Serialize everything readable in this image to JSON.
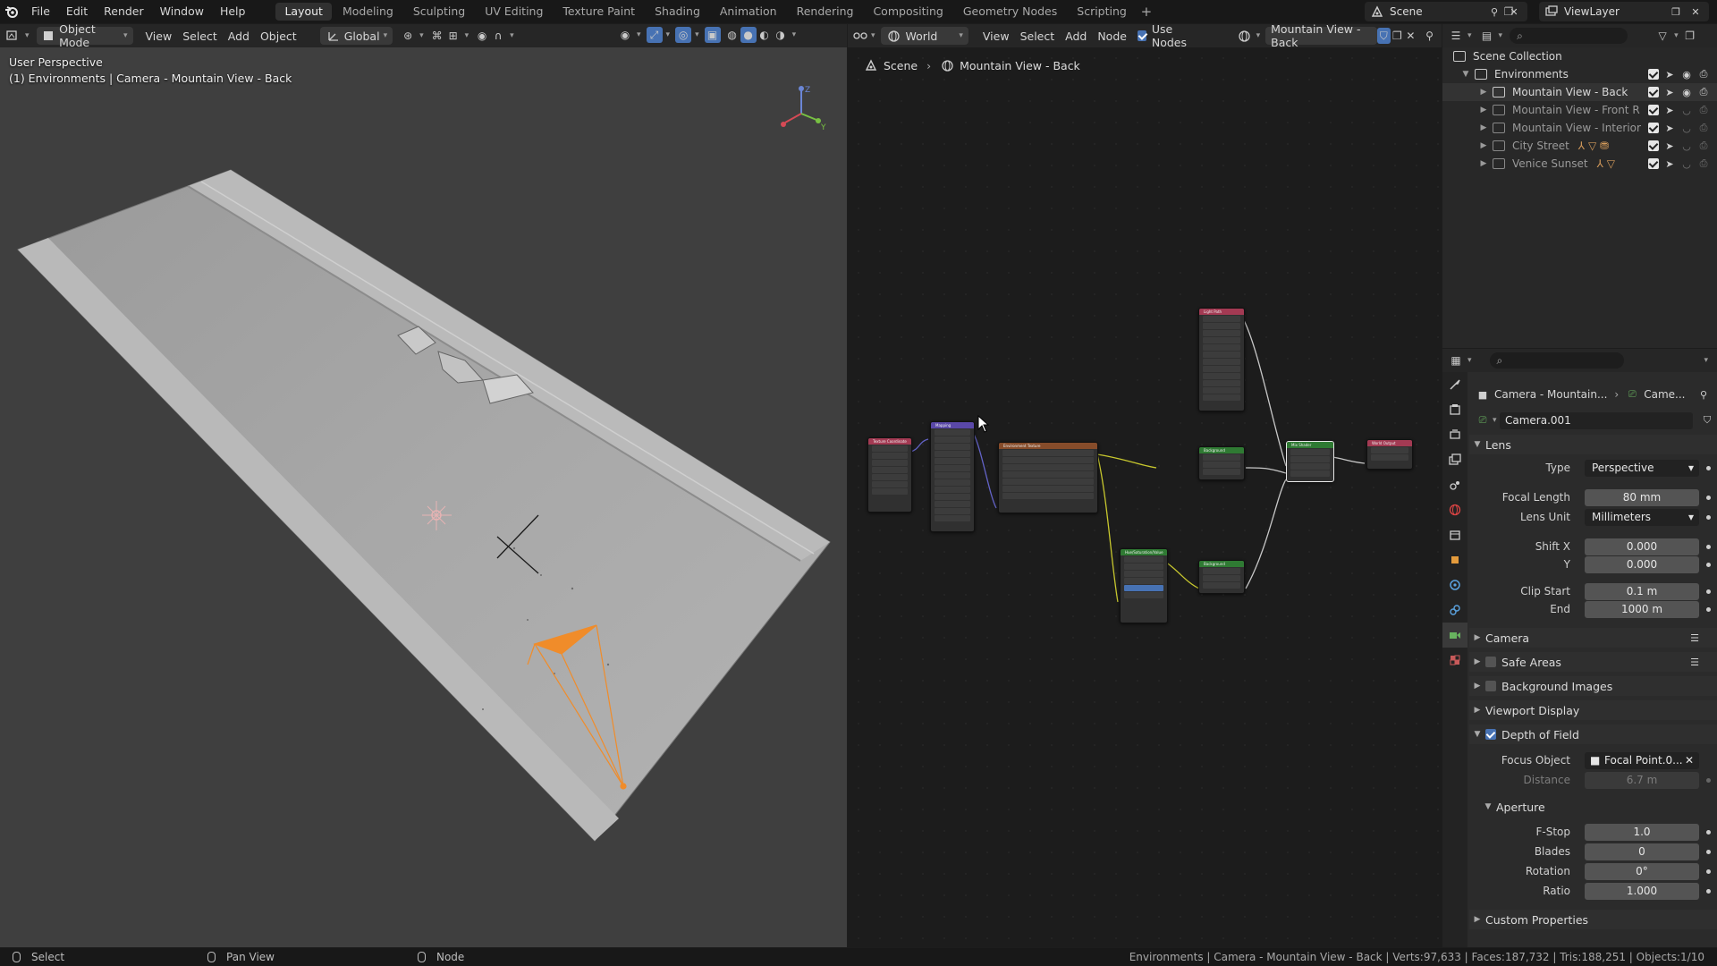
{
  "topbar": {
    "menus": [
      "File",
      "Edit",
      "Render",
      "Window",
      "Help"
    ],
    "workspaces": [
      "Layout",
      "Modeling",
      "Sculpting",
      "UV Editing",
      "Texture Paint",
      "Shading",
      "Animation",
      "Rendering",
      "Compositing",
      "Geometry Nodes",
      "Scripting"
    ],
    "active_workspace": "Layout",
    "add_workspace": "+",
    "scene": "Scene",
    "view_layer": "ViewLayer"
  },
  "viewport": {
    "mode": "Object Mode",
    "menus": [
      "View",
      "Select",
      "Add",
      "Object"
    ],
    "orientation": "Global",
    "overlay_title": "User Perspective",
    "overlay_subtitle": "(1) Environments | Camera - Mountain View - Back",
    "gizmo_axes": {
      "x": "X",
      "y": "Y",
      "z": "Z"
    }
  },
  "node_editor": {
    "shader_type": "World",
    "menus": [
      "View",
      "Select",
      "Add",
      "Node"
    ],
    "use_nodes_label": "Use Nodes",
    "use_nodes": true,
    "world_name": "Mountain View - Back",
    "breadcrumb": [
      "Scene",
      "Mountain View - Back"
    ],
    "nodes": [
      {
        "id": "texcoord",
        "title": "Texture Coordinate",
        "color": "#a33a53"
      },
      {
        "id": "mapping",
        "title": "Mapping",
        "color": "#5a48a8"
      },
      {
        "id": "envtex",
        "title": "Environment Texture",
        "color": "#864c2a"
      },
      {
        "id": "huesat",
        "title": "Hue/Saturation/Value",
        "color": "#2f7a33"
      },
      {
        "id": "lightpath",
        "title": "Light Path",
        "color": "#a33a53"
      },
      {
        "id": "bg1",
        "title": "Background",
        "color": "#2f7a33"
      },
      {
        "id": "bg2",
        "title": "Background",
        "color": "#2f7a33"
      },
      {
        "id": "mix",
        "title": "Mix Shader",
        "color": "#2f7a33"
      },
      {
        "id": "output",
        "title": "World Output",
        "color": "#a33a53"
      }
    ]
  },
  "outliner": {
    "root": "Scene Collection",
    "collection": "Environments",
    "children": [
      {
        "name": "Mountain View - Back",
        "active": true
      },
      {
        "name": "Mountain View - Front R",
        "active": false
      },
      {
        "name": "Mountain View - Interior",
        "active": false
      },
      {
        "name": "City Street",
        "active": false
      },
      {
        "name": "Venice Sunset",
        "active": false
      }
    ]
  },
  "properties": {
    "breadcrumb_object": "Camera - Mountain...",
    "breadcrumb_data": "Came...",
    "data_name": "Camera.001",
    "lens_panel": "Lens",
    "type_label": "Type",
    "type_value": "Perspective",
    "focal_length_label": "Focal Length",
    "focal_length": "80 mm",
    "lens_unit_label": "Lens Unit",
    "lens_unit": "Millimeters",
    "shift_x_label": "Shift X",
    "shift_x": "0.000",
    "shift_y_label": "Y",
    "shift_y": "0.000",
    "clip_start_label": "Clip Start",
    "clip_start": "0.1 m",
    "clip_end_label": "End",
    "clip_end": "1000 m",
    "camera_panel": "Camera",
    "safe_areas_panel": "Safe Areas",
    "background_images_panel": "Background Images",
    "viewport_display_panel": "Viewport Display",
    "dof_panel": "Depth of Field",
    "dof_enabled": true,
    "focus_object_label": "Focus Object",
    "focus_object": "Focal Point.0...",
    "distance_label": "Distance",
    "distance": "6.7 m",
    "aperture_panel": "Aperture",
    "fstop_label": "F-Stop",
    "fstop": "1.0",
    "blades_label": "Blades",
    "blades": "0",
    "rotation_label": "Rotation",
    "rotation": "0°",
    "ratio_label": "Ratio",
    "ratio": "1.000",
    "custom_props_panel": "Custom Properties"
  },
  "statusbar": {
    "select": "Select",
    "pan_view": "Pan View",
    "node": "Node",
    "stats": "Environments | Camera - Mountain View - Back | Verts:97,633 | Faces:187,732 | Tris:188,251 | Objects:1/10"
  },
  "colors": {
    "accent": "#4772b3",
    "camera_selected": "#f08c2a",
    "link_yellow": "#c7c72e",
    "link_purple": "#6363c7",
    "link_gray": "#c7c7c7"
  }
}
